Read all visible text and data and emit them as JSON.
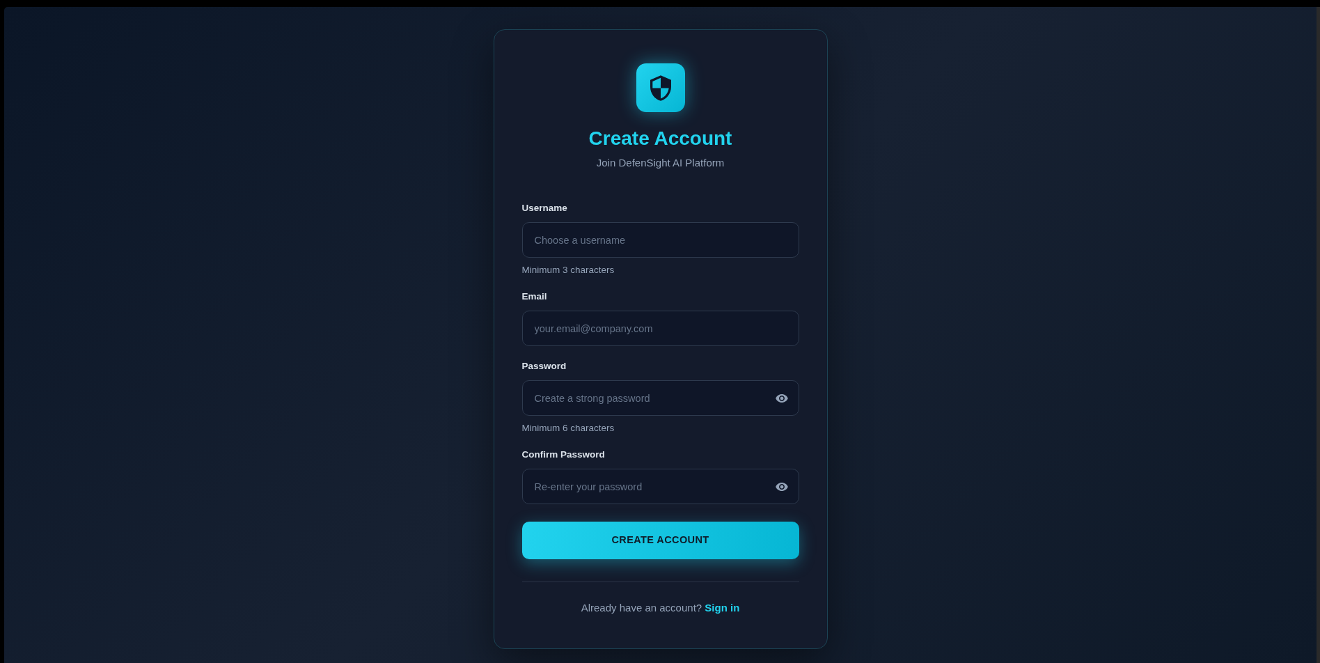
{
  "header": {
    "title": "Create Account",
    "subtitle": "Join DefenSight AI Platform"
  },
  "fields": [
    {
      "kind": "text",
      "label": "Username",
      "placeholder": "Choose a username",
      "hint": "Minimum 3 characters"
    },
    {
      "kind": "email",
      "label": "Email",
      "placeholder": "your.email@company.com"
    },
    {
      "kind": "password",
      "label": "Password",
      "placeholder": "Create a strong password",
      "hint": "Minimum 6 characters"
    },
    {
      "kind": "password",
      "label": "Confirm Password",
      "placeholder": "Re-enter your password"
    }
  ],
  "submit_button": {
    "label": "CREATE ACCOUNT"
  },
  "footer": {
    "prompt": "Already have an account?",
    "link": "Sign in"
  }
}
